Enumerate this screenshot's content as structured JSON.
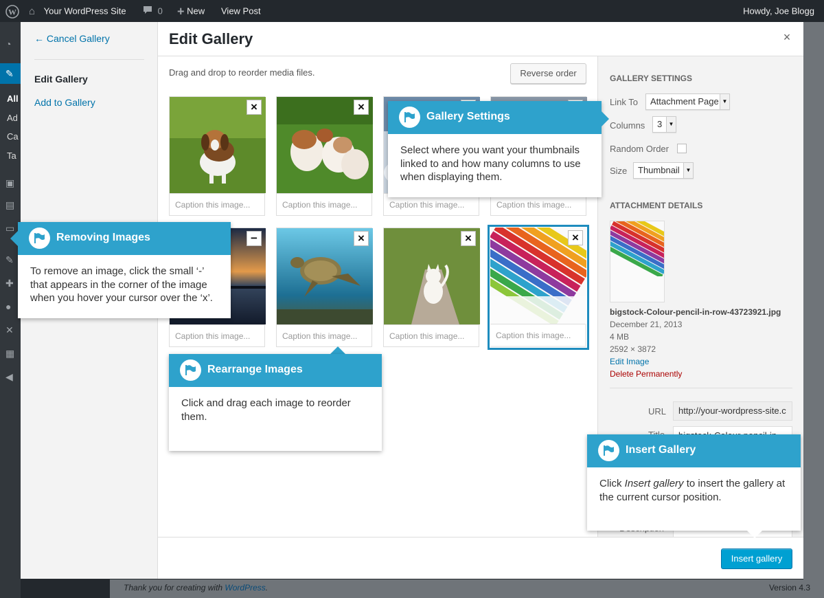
{
  "admin_bar": {
    "site_name": "Your WordPress Site",
    "comments_count": "0",
    "new_label": "New",
    "view_post_label": "View Post",
    "howdy": "Howdy, Joe Blogg"
  },
  "admin_sidebar": {
    "partial_items": [
      "All",
      "Ad",
      "Ca",
      "Ta"
    ]
  },
  "modal": {
    "menu": {
      "cancel": "← Cancel Gallery",
      "active": "Edit Gallery",
      "add": "Add to Gallery"
    },
    "title": "Edit Gallery",
    "close_glyph": "×",
    "hint": "Drag and drop to reorder media files.",
    "reverse_order": "Reverse order",
    "remove_glyph": "×",
    "hover_remove_glyph": "−",
    "tiles": [
      {
        "caption": "Caption this image...",
        "subject": "beagle-puppy"
      },
      {
        "caption": "Caption this image...",
        "subject": "bulldog-puppies"
      },
      {
        "caption": "Caption this image...",
        "subject": "snowy-scene"
      },
      {
        "caption": "Caption this image...",
        "subject": "partially-hidden"
      },
      {
        "caption": "Caption this image...",
        "subject": "sunset-pier"
      },
      {
        "caption": "Caption this image...",
        "subject": "sea-turtle"
      },
      {
        "caption": "Caption this image...",
        "subject": "white-kitten"
      },
      {
        "caption": "Caption this image...",
        "subject": "colour-pencils",
        "selected": true
      }
    ],
    "settings": {
      "heading": "Gallery Settings",
      "link_to_label": "Link To",
      "link_to_value": "Attachment Page",
      "columns_label": "Columns",
      "columns_value": "3",
      "random_order_label": "Random Order",
      "random_order_checked": false,
      "size_label": "Size",
      "size_value": "Thumbnail",
      "details_heading": "Attachment Details",
      "filename": "bigstock-Colour-pencil-in-row-43723921.jpg",
      "date": "December 21, 2013",
      "filesize": "4 MB",
      "dimensions": "2592 × 3872",
      "edit_image": "Edit Image",
      "delete": "Delete Permanently",
      "url_label": "URL",
      "url_value": "http://your-wordpress-site.c",
      "title_label": "Title",
      "title_value": "bigstock-Colour-pencil-in",
      "description_label": "Description"
    },
    "insert_button": "Insert gallery"
  },
  "callouts": {
    "gallery_settings": {
      "title": "Gallery Settings",
      "body": "Select where you want  your thumbnails linked to and how many columns to use when displaying them."
    },
    "removing_images": {
      "title": "Removing Images",
      "body": "To remove an image, click the small ‘-’ that appears in the corner of the image when you hover your cursor over the ‘x’."
    },
    "rearrange_images": {
      "title": "Rearrange Images",
      "body": "Click and drag each image to reorder them."
    },
    "insert_gallery": {
      "title": "Insert Gallery",
      "body_em": "Insert gallery",
      "body_pre": "Click ",
      "body_post": " to insert the gallery at the current cursor position."
    }
  },
  "footer": {
    "thanks_prefix": "Thank you for creating with ",
    "thanks_link": "WordPress",
    "thanks_suffix": ".",
    "version": "Version 4.3"
  },
  "colors": {
    "accent": "#2ea2cc",
    "primary_button": "#00a0d2",
    "link": "#0073aa",
    "delete": "#aa0000",
    "admin_bar": "#23282d"
  }
}
